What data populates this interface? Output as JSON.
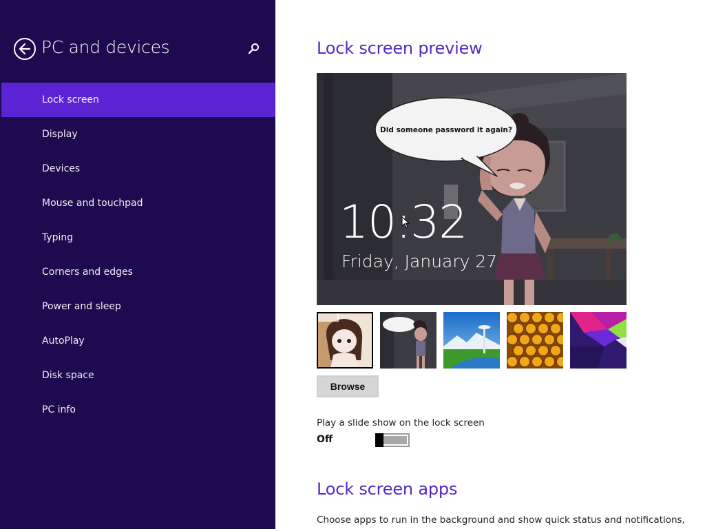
{
  "sidebar": {
    "title": "PC and devices",
    "back_icon": "back-arrow-icon",
    "search_icon": "search-icon",
    "items": [
      {
        "label": "Lock screen",
        "selected": true
      },
      {
        "label": "Display"
      },
      {
        "label": "Devices"
      },
      {
        "label": "Mouse and touchpad"
      },
      {
        "label": "Typing"
      },
      {
        "label": "Corners and edges"
      },
      {
        "label": "Power and sleep"
      },
      {
        "label": "AutoPlay"
      },
      {
        "label": "Disk space"
      },
      {
        "label": "PC info"
      }
    ]
  },
  "main": {
    "preview_heading": "Lock screen preview",
    "preview": {
      "speech": "Did someone password it again?",
      "time": "10:32",
      "date": "Friday, January 27"
    },
    "thumbnails": [
      {
        "name": "cartoon-girl-thumbnail",
        "selected": true
      },
      {
        "name": "cartoon-speech-bubble-thumbnail"
      },
      {
        "name": "space-needle-thumbnail"
      },
      {
        "name": "honeycomb-thumbnail"
      },
      {
        "name": "colorful-geometric-thumbnail"
      }
    ],
    "browse_label": "Browse",
    "slideshow_label": "Play a slide show on the lock screen",
    "slideshow_state": "Off",
    "apps_heading": "Lock screen apps",
    "apps_description": "Choose apps to run in the background and show quick status and notifications,"
  },
  "colors": {
    "sidebar_bg": "#1e0a4e",
    "selected_item": "#5b23d4",
    "heading": "#5729c4"
  }
}
